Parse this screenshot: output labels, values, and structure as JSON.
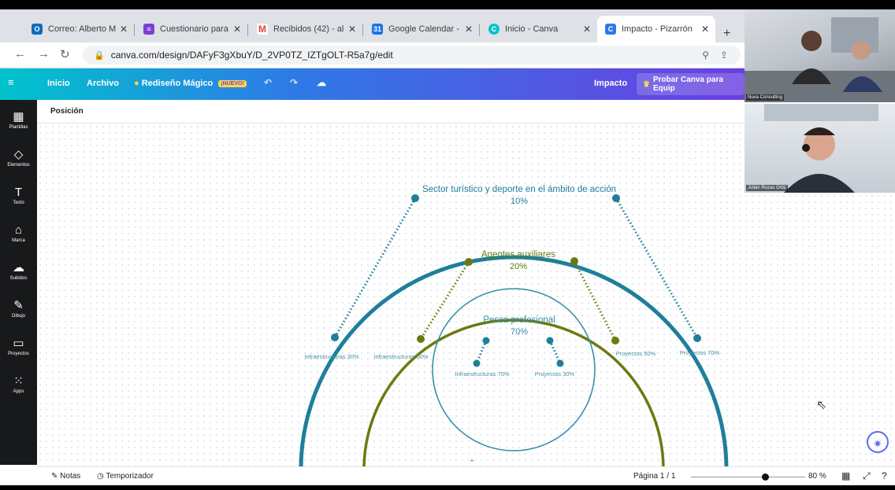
{
  "browser": {
    "tabs": [
      {
        "title": "Correo: Alberto M",
        "icon": "outlook-icon",
        "color": "#0f6cbd",
        "active": false
      },
      {
        "title": "Cuestionario para",
        "icon": "forms-icon",
        "color": "#7b3fd6",
        "active": false
      },
      {
        "title": "Recibidos (42) - al",
        "icon": "gmail-icon",
        "color": "#ea4335",
        "active": false
      },
      {
        "title": "Google Calendar -",
        "icon": "calendar-icon",
        "color": "#1a73e8",
        "active": false
      },
      {
        "title": "Inicio - Canva",
        "icon": "canva-icon",
        "color": "#00c4cc",
        "active": false
      },
      {
        "title": "Impacto - Pizarrón",
        "icon": "canva-icon",
        "color": "#2f79e6",
        "active": true
      }
    ],
    "url": "canva.com/design/DAFyF3gXbuY/D_2VP0TZ_IZTgOLT-R5a7g/edit"
  },
  "canva": {
    "header": {
      "inicio": "Inicio",
      "archivo": "Archivo",
      "rediseno": "Rediseño Mágico",
      "nuevo": "¡NUEVO!",
      "title": "Impacto",
      "probar": "Probar Canva para Equip"
    },
    "sidebar": [
      {
        "label": "Plantillas",
        "icon": "templates-icon",
        "glyph": "▦"
      },
      {
        "label": "Elementos",
        "icon": "elements-icon",
        "glyph": "◇"
      },
      {
        "label": "Texto",
        "icon": "text-icon",
        "glyph": "T"
      },
      {
        "label": "Marca",
        "icon": "brand-icon",
        "glyph": "⌂"
      },
      {
        "label": "Subidos",
        "icon": "upload-icon",
        "glyph": "☁"
      },
      {
        "label": "Dibujo",
        "icon": "draw-icon",
        "glyph": "✎"
      },
      {
        "label": "Proyectos",
        "icon": "folder-icon",
        "glyph": "▭"
      },
      {
        "label": "Apps",
        "icon": "apps-icon",
        "glyph": "⁙"
      }
    ],
    "toolbar": {
      "position_label": "Posición"
    },
    "diagram": {
      "outer": {
        "title": "Sector turístico y deporte en el ámbito de acción",
        "percent": "10%",
        "left_label": "Infraestructuras 30%",
        "right_label": "Proyectos 70%",
        "color": "#1f7f9a"
      },
      "middle": {
        "title": "Agentes auxiliares",
        "percent": "20%",
        "left_label": "Infraestructuras 50%",
        "right_label": "Proyectos 50%",
        "color": "#6b7a10"
      },
      "inner": {
        "title": "Pesca profesional",
        "percent": "70%",
        "left_label": "Infraestructuras 70%",
        "right_label": "Proyectos 30%",
        "color": "#2f8fa8"
      }
    },
    "bottom": {
      "notas": "Notas",
      "temporizador": "Temporizador",
      "page": "Página 1 / 1",
      "zoom": "80 %"
    }
  },
  "video": {
    "tile1_label": "Nuva Consulting",
    "tile2_label": "Julián Rozas Ortiz"
  }
}
